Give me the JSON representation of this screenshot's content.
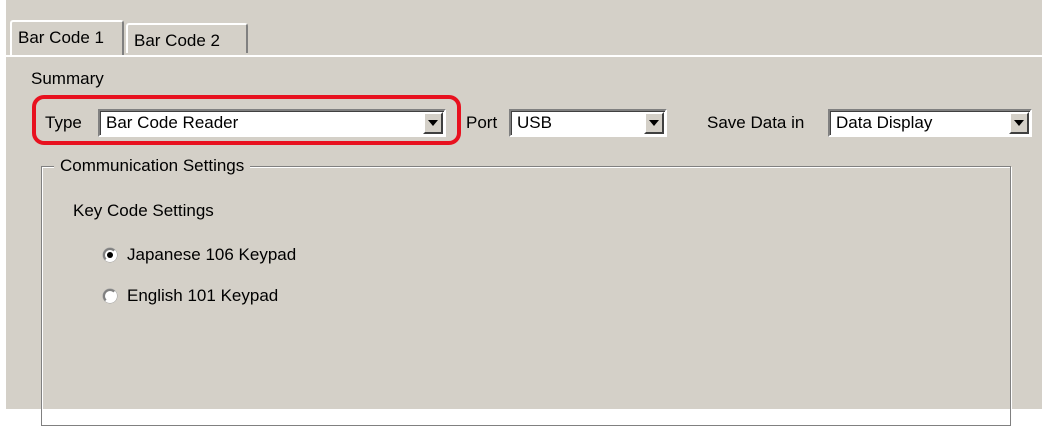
{
  "tabs": [
    {
      "label": "Bar Code 1",
      "active": true
    },
    {
      "label": "Bar Code 2",
      "active": false
    }
  ],
  "summary": {
    "label": "Summary",
    "type_label": "Type",
    "type_value": "Bar Code Reader",
    "port_label": "Port",
    "port_value": "USB",
    "save_label": "Save Data in",
    "save_value": "Data Display"
  },
  "communication": {
    "legend": "Communication Settings",
    "key_code_label": "Key Code Settings",
    "options": [
      {
        "label": "Japanese 106 Keypad",
        "selected": true
      },
      {
        "label": "English 101 Keypad",
        "selected": false
      }
    ]
  },
  "colors": {
    "highlight": "#e8111f",
    "face": "#d4d0c8"
  }
}
